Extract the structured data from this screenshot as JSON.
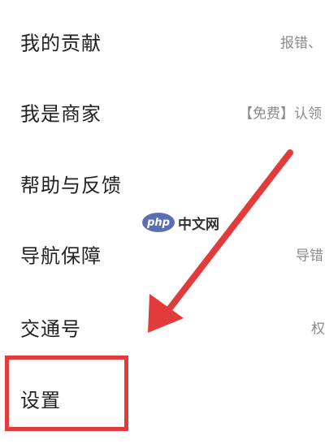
{
  "menu": {
    "items": [
      {
        "label": "我的贡献",
        "hint": "报错、"
      },
      {
        "label": "我是商家",
        "hint": "【免费】认领"
      },
      {
        "label": "帮助与反馈",
        "hint": ""
      },
      {
        "label": "导航保障",
        "hint": "导错"
      },
      {
        "label": "交通号",
        "hint": "权"
      },
      {
        "label": "设置",
        "hint": ""
      }
    ]
  },
  "watermark": {
    "badge": "php",
    "text": "中文网"
  },
  "annotation": {
    "color": "#e23b3b",
    "target": "settings"
  }
}
